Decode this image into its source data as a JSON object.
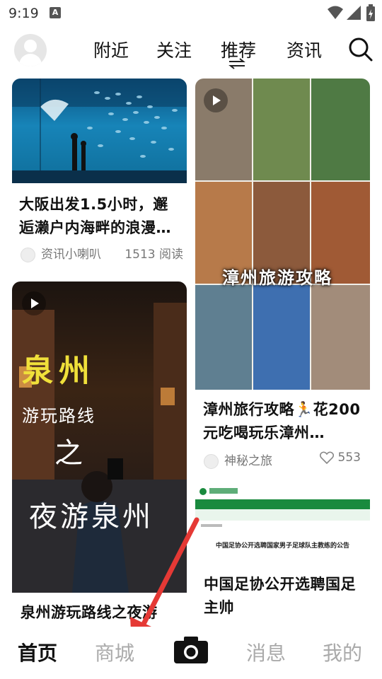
{
  "status": {
    "time": "9:19",
    "notification_icon": "A"
  },
  "top_tabs": [
    {
      "label": "附近"
    },
    {
      "label": "关注"
    },
    {
      "label": "推荐"
    },
    {
      "label": "资讯"
    }
  ],
  "cards": [
    {
      "title": "大阪出发1.5小时，邂逅濑户内海畔的浪漫…",
      "author": "资讯小喇叭",
      "stat": "1513 阅读"
    },
    {
      "title": "漳州旅行攻略🏃花200元吃喝玩乐漳州…",
      "author": "神秘之旅",
      "likes": "553",
      "overlay_text": "漳州旅游攻略"
    },
    {
      "title": "泉州游玩路线之夜游",
      "overlay_lines": [
        "泉州",
        "游玩路线",
        "之",
        "夜游泉州"
      ]
    },
    {
      "title": "中国足协公开选聘国足主帅",
      "header_text": "中国足协公开选聘国家男子足球队主教练的公告"
    }
  ],
  "bottom_tabs": [
    {
      "label": "首页"
    },
    {
      "label": "商城"
    },
    {
      "label": "消息"
    },
    {
      "label": "我的"
    }
  ],
  "colors": {
    "arrow": "#e53935",
    "active_tab": "#111111",
    "inactive_tab": "#aaaaaa"
  }
}
